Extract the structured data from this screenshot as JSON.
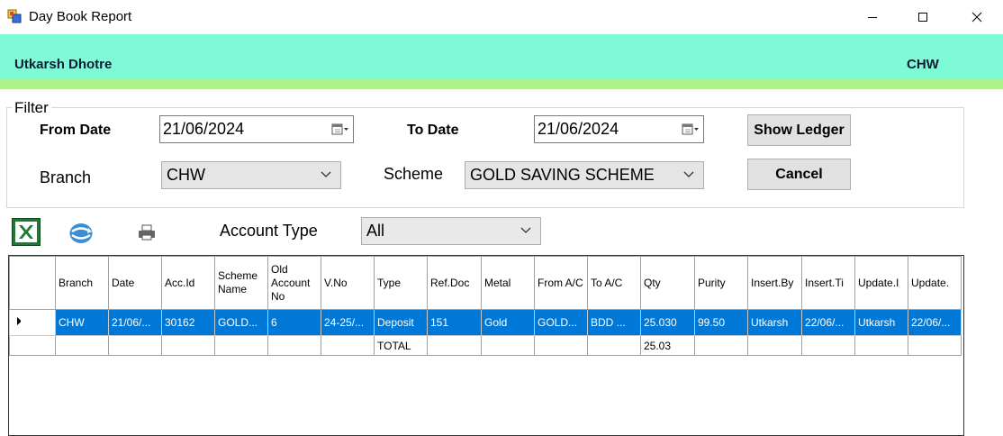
{
  "window": {
    "title": "Day Book Report"
  },
  "header": {
    "user_name": "Utkarsh Dhotre",
    "branch_code": "CHW",
    "colors": {
      "band": "#7ffad6",
      "strip": "#aef28c"
    }
  },
  "filter": {
    "legend": "Filter",
    "from_date_label": "From Date",
    "from_date_value": "21/06/2024",
    "to_date_label": "To Date",
    "to_date_value": "21/06/2024",
    "branch_label": "Branch",
    "branch_value": "CHW",
    "scheme_label": "Scheme",
    "scheme_value": "GOLD SAVING SCHEME",
    "show_ledger_label": "Show Ledger",
    "cancel_label": "Cancel"
  },
  "toolbar": {
    "icons": [
      "excel-icon",
      "refresh-icon",
      "printer-icon"
    ],
    "account_type_label": "Account Type",
    "account_type_value": "All"
  },
  "grid": {
    "columns": [
      "Branch",
      "Date",
      "Acc.Id",
      "Scheme Name",
      "Old Account No",
      "V.No",
      "Type",
      "Ref.Doc",
      "Metal",
      "From A/C",
      "To A/C",
      "Qty",
      "Purity",
      "Insert.By",
      "Insert.Ti",
      "Update.I",
      "Update."
    ],
    "rows": [
      [
        "CHW",
        "21/06/...",
        "30162",
        "GOLD...",
        "6",
        "24-25/...",
        "Deposit",
        "151",
        "Gold",
        "GOLD...",
        "BDD ...",
        "25.030",
        "99.50",
        "Utkarsh",
        "22/06/...",
        "Utkarsh",
        "22/06/..."
      ]
    ],
    "total_row": [
      "",
      "",
      "",
      "",
      "",
      "",
      "TOTAL",
      "",
      "",
      "",
      "",
      "25.03",
      "",
      "",
      "",
      "",
      ""
    ],
    "selection_color": "#0078d7"
  }
}
